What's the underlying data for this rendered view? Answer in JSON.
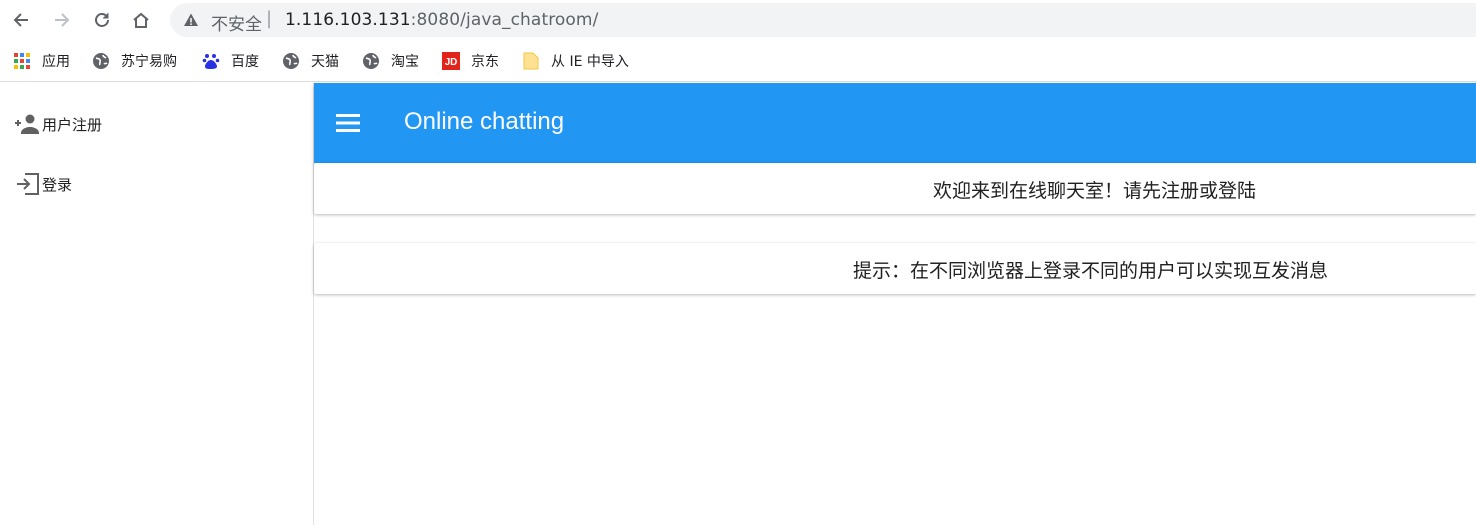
{
  "browser": {
    "security_label": "不安全",
    "separator": "|",
    "url_host": "1.116.103.131",
    "url_rest": ":8080/java_chatroom/"
  },
  "bookmarks": [
    {
      "label": "应用",
      "icon": "apps-grid-icon"
    },
    {
      "label": "苏宁易购",
      "icon": "globe-icon"
    },
    {
      "label": "百度",
      "icon": "baidu-paw-icon"
    },
    {
      "label": "天猫",
      "icon": "globe-icon"
    },
    {
      "label": "淘宝",
      "icon": "globe-icon"
    },
    {
      "label": "京东",
      "icon": "jd-logo-icon"
    },
    {
      "label": "从 IE 中导入",
      "icon": "folder-icon"
    }
  ],
  "drawer": {
    "items": [
      {
        "label": "用户注册",
        "icon": "person-add-icon"
      },
      {
        "label": "登录",
        "icon": "login-icon"
      }
    ]
  },
  "appbar": {
    "title": "Online chatting"
  },
  "messages": {
    "welcome": "欢迎来到在线聊天室！请先注册或登陆",
    "hint": "提示：在不同浏览器上登录不同的用户可以实现互发消息"
  },
  "colors": {
    "appbar": "#2196f3",
    "jd_red": "#e1251b",
    "baidu_blue": "#2932e1"
  }
}
